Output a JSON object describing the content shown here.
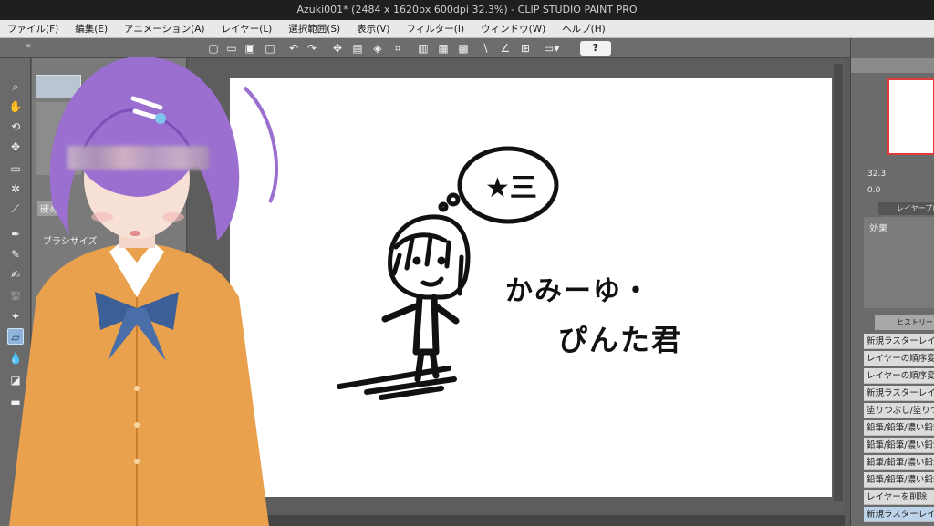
{
  "window": {
    "title": "Azuki001* (2484 x 1620px 600dpi 32.3%) - CLIP STUDIO PAINT PRO"
  },
  "menu": [
    "ファイル(F)",
    "編集(E)",
    "アニメーション(A)",
    "レイヤー(L)",
    "選択範囲(S)",
    "表示(V)",
    "フィルター(I)",
    "ウィンドウ(W)",
    "ヘルプ(H)"
  ],
  "command_bar": {
    "icons": [
      "new-icon",
      "open-icon",
      "save-icon",
      "undo-icon",
      "redo-icon",
      "clear-icon",
      "transform-icon",
      "fill-icon",
      "snap-icon",
      "ruler-icon",
      "help-icon"
    ],
    "help_label": "?"
  },
  "tools": [
    "zoom-icon",
    "hand-icon",
    "rotate-icon",
    "move-icon",
    "selection-icon",
    "magic-wand-icon",
    "eyedropper-icon",
    "pen-icon",
    "pencil-icon",
    "brush-icon",
    "airbrush-icon",
    "decoration-icon",
    "eraser-icon",
    "blend-icon",
    "fill-icon"
  ],
  "sub_tool": {
    "partial_item_label": "硬め",
    "property_label": "ブラシサイズ"
  },
  "canvas": {
    "thought_bubble_text": "★三",
    "handwriting_line1": "かみーゆ・",
    "handwriting_line2": "ぴんた君"
  },
  "dock": {
    "layer_property_tab": "レイヤープロパティ",
    "effect_label": "効果",
    "zoom_value": "32.3",
    "rotate_value": "0.0",
    "history_tab": "ヒストリー",
    "history": [
      "新規ラスターレイヤー",
      "レイヤーの順序変更",
      "レイヤーの順序変更",
      "新規ラスターレイヤー",
      "塗りつぶし/塗りつぶし",
      "鉛筆/鉛筆/濃い鉛筆",
      "鉛筆/鉛筆/濃い鉛筆",
      "鉛筆/鉛筆/濃い鉛筆",
      "鉛筆/鉛筆/濃い鉛筆",
      "レイヤーを削除",
      "新規ラスターレイヤー"
    ]
  },
  "colors": {
    "accent_red": "#e23b3b",
    "hair": "#9a6fd0",
    "cardigan": "#e9a14e"
  }
}
